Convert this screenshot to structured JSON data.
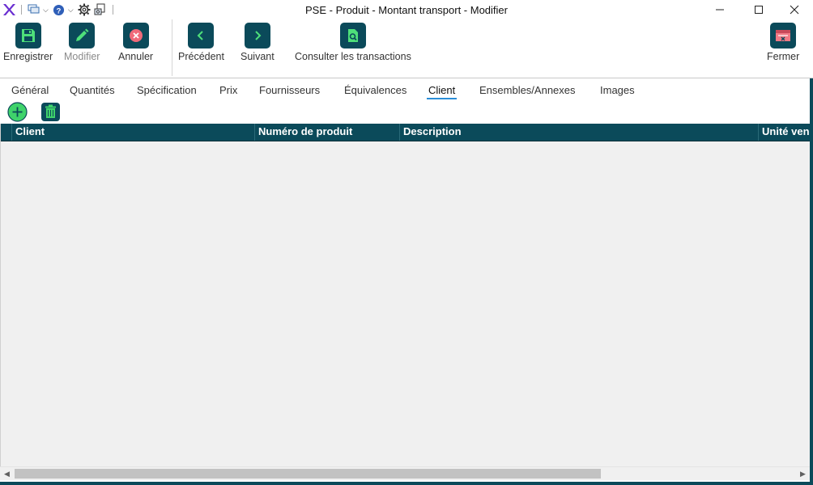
{
  "window": {
    "title": "PSE - Produit - Montant transport - Modifier"
  },
  "quick_access": {
    "icons": [
      "app-logo-icon",
      "windows-icon",
      "help-icon",
      "settings-icon",
      "print-icon"
    ]
  },
  "toolbar": {
    "save_label": "Enregistrer",
    "edit_label": "Modifier",
    "cancel_label": "Annuler",
    "previous_label": "Précédent",
    "next_label": "Suivant",
    "transactions_label": "Consulter les transactions",
    "close_label": "Fermer"
  },
  "tabs": [
    {
      "label": "Général"
    },
    {
      "label": "Quantités"
    },
    {
      "label": "Spécification"
    },
    {
      "label": "Prix"
    },
    {
      "label": "Fournisseurs"
    },
    {
      "label": "Équivalences"
    },
    {
      "label": "Client",
      "active": true
    },
    {
      "label": "Ensembles/Annexes"
    },
    {
      "label": "Images"
    }
  ],
  "grid": {
    "columns": [
      "Client",
      "Numéro de produit",
      "Description",
      "Unité ven"
    ],
    "rows": []
  },
  "colors": {
    "accent": "#0b4a5a",
    "tab_underline": "#2a8ed8",
    "add_button": "#3fd36b"
  }
}
